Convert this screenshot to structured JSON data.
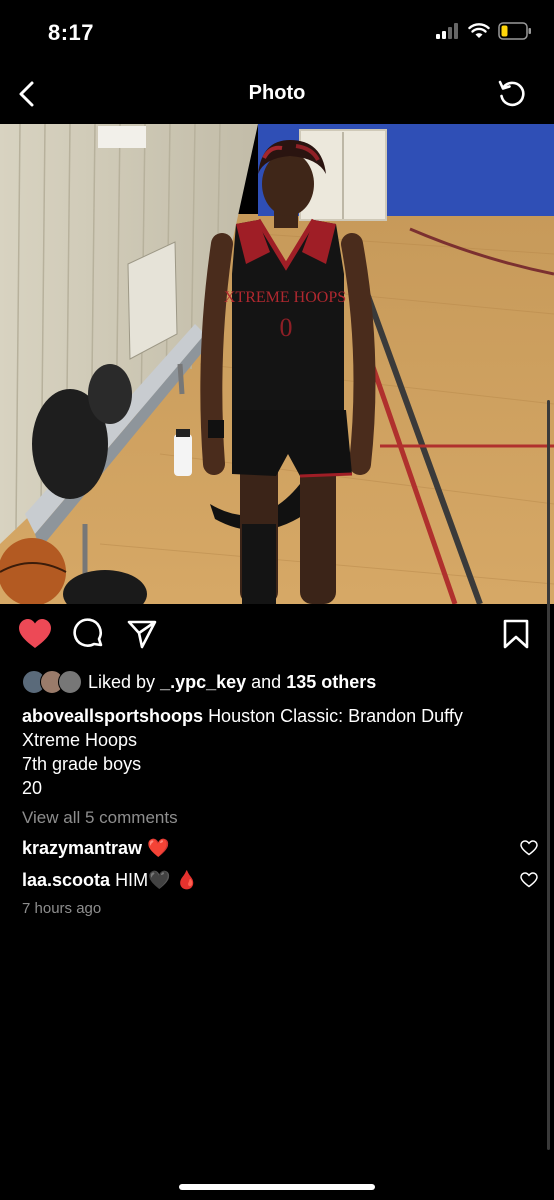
{
  "status": {
    "time": "8:17"
  },
  "nav": {
    "title": "Photo"
  },
  "likes": {
    "prefix": "Liked by",
    "user": "_.ypc_key",
    "joiner": "and",
    "others": "135 others"
  },
  "caption": {
    "username": "aboveallsportshoops",
    "line1": "Houston Classic:  Brandon Duffy",
    "line2": "Xtreme Hoops",
    "line3": "7th grade boys",
    "line4": "20"
  },
  "comments": {
    "view_all": "View all 5 comments",
    "items": [
      {
        "username": "krazymantraw",
        "text": "❤️"
      },
      {
        "username": "laa.scoota",
        "text": "HIM🖤 🩸"
      }
    ]
  },
  "timestamp": "7 hours ago",
  "jersey": {
    "team": "XTREME HOOPS",
    "number": "0"
  },
  "colors": {
    "like_red": "#ed4956",
    "muted": "#8e8e8e",
    "background": "#000000"
  },
  "icons": [
    "back-icon",
    "refresh-icon",
    "heart-filled-icon",
    "comment-icon",
    "share-icon",
    "bookmark-icon"
  ]
}
